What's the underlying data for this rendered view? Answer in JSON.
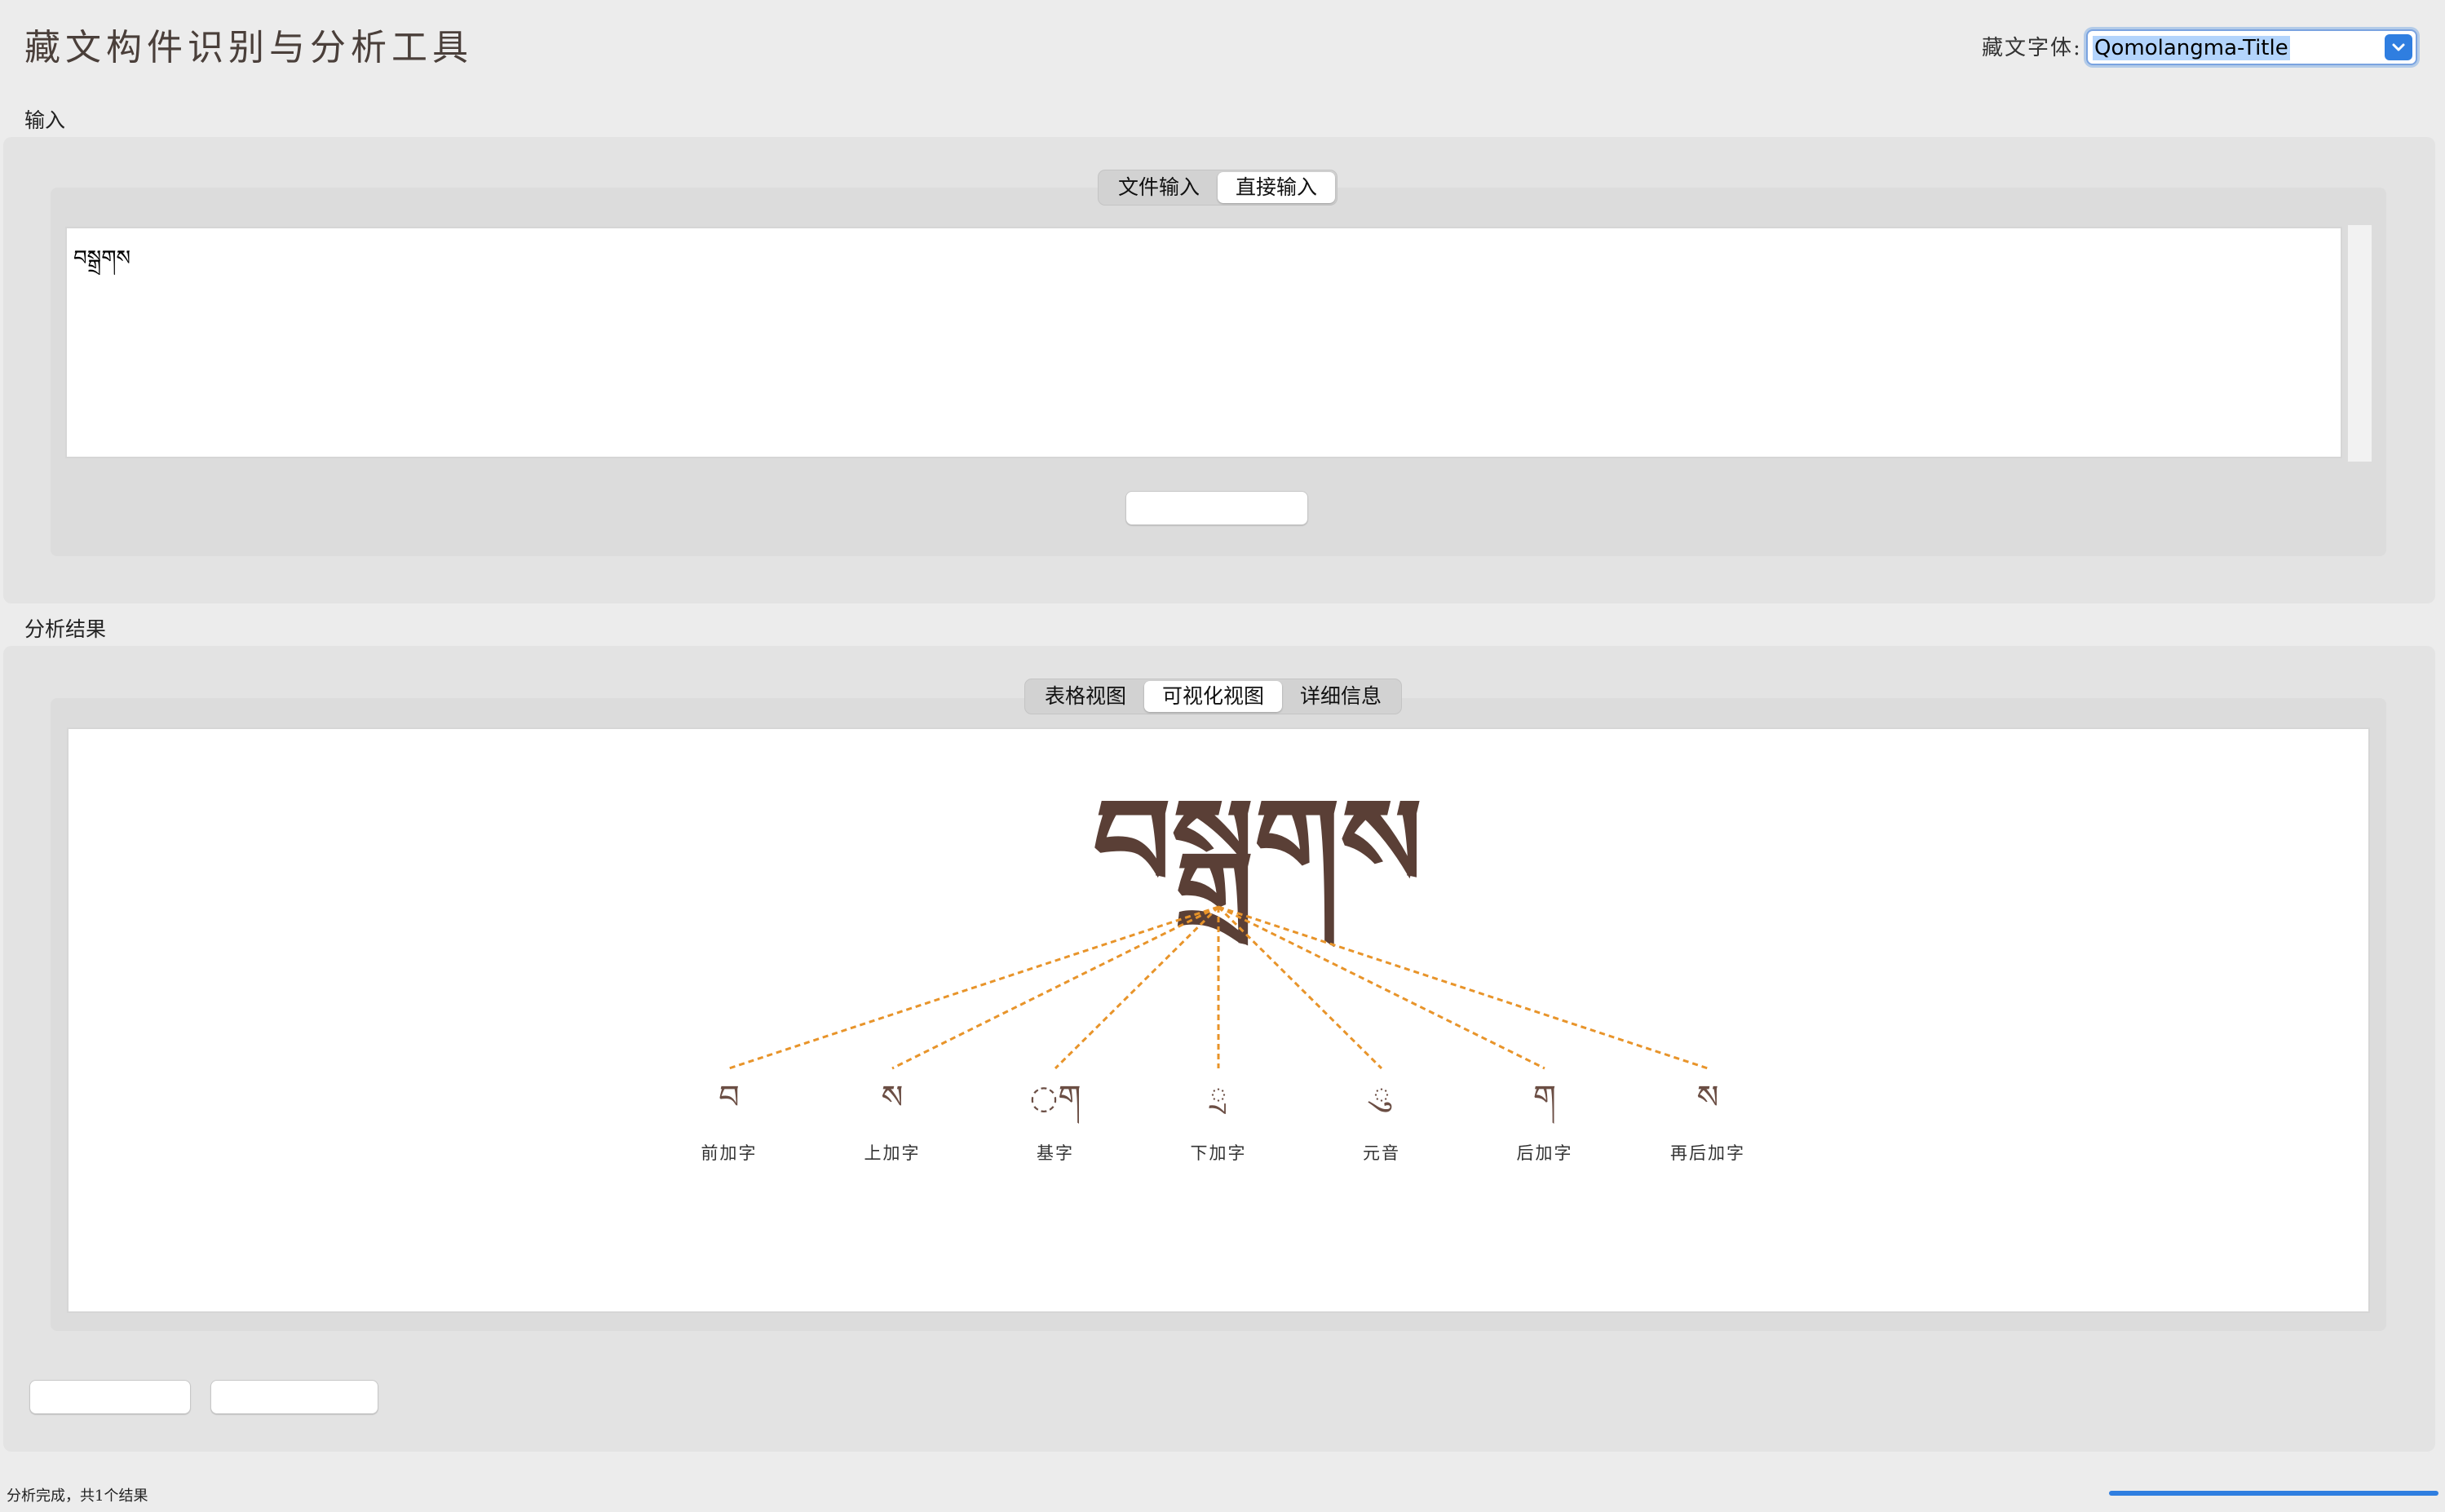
{
  "app": {
    "title": "藏文构件识别与分析工具"
  },
  "font_selector": {
    "label": "藏文字体:",
    "selected": "Qomolangma-Title"
  },
  "input_section": {
    "label": "输入",
    "tabs": [
      {
        "label": "文件输入",
        "active": false
      },
      {
        "label": "直接输入",
        "active": true
      }
    ],
    "text": "བསྒྲགས"
  },
  "results_section": {
    "label": "分析结果",
    "tabs": [
      {
        "label": "表格视图",
        "active": false
      },
      {
        "label": "可视化视图",
        "active": true
      },
      {
        "label": "详细信息",
        "active": false
      }
    ],
    "syllable": "བསྒྲགས",
    "components": [
      {
        "glyph": "བ",
        "label": "前加字"
      },
      {
        "glyph": "ས",
        "label": "上加字"
      },
      {
        "glyph": "◌ག",
        "label": "基字"
      },
      {
        "glyph": "◌ྲ",
        "label": "下加字"
      },
      {
        "glyph": "◌ུ",
        "label": "元音"
      },
      {
        "glyph": "ག",
        "label": "后加字"
      },
      {
        "glyph": "ས",
        "label": "再后加字"
      }
    ],
    "connector_color": "#e8942a"
  },
  "status": {
    "text": "分析完成，共1个结果",
    "progress": 1.0,
    "accent_color": "#2f7ee0"
  },
  "icons": {
    "dropdown": "chevron-down-icon"
  }
}
